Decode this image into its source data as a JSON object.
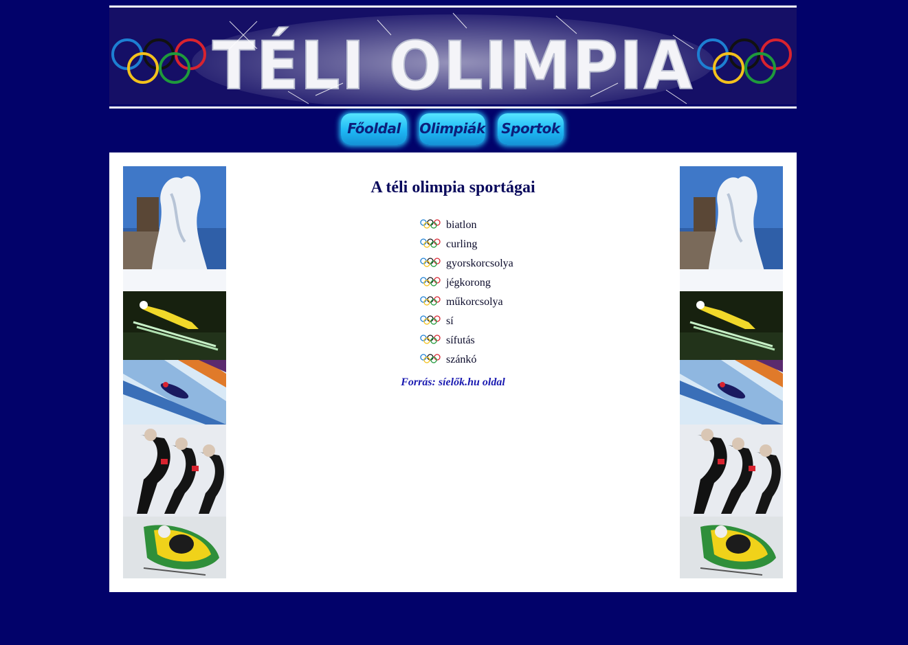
{
  "header": {
    "title": "TÉLI OLIMPIA",
    "logo_icon": "olympic-rings-icon"
  },
  "nav": {
    "items": [
      {
        "label": "Főoldal"
      },
      {
        "label": "Olimpiák"
      },
      {
        "label": "Sportok"
      }
    ]
  },
  "main": {
    "heading": "A téli olimpia sportágai",
    "list_icon": "olympic-rings-icon",
    "sports": [
      "biatlon",
      "curling",
      "gyorskorcsolya",
      "jégkorong",
      "műkorcsolya",
      "sí",
      "sífutás",
      "szánkó"
    ],
    "source_text": "Forrás: síelők.hu oldal"
  },
  "photos": [
    {
      "name": "ice-sculpture-photo"
    },
    {
      "name": "ski-jumper-photo"
    },
    {
      "name": "luge-photo"
    },
    {
      "name": "speed-skaters-photo"
    },
    {
      "name": "bobsleigh-photo"
    }
  ],
  "colors": {
    "background": "#02026a",
    "banner": "#150f66",
    "nav_button": "#1eb8f4",
    "heading": "#0a0a5c",
    "source_link": "#1a1ab0"
  }
}
